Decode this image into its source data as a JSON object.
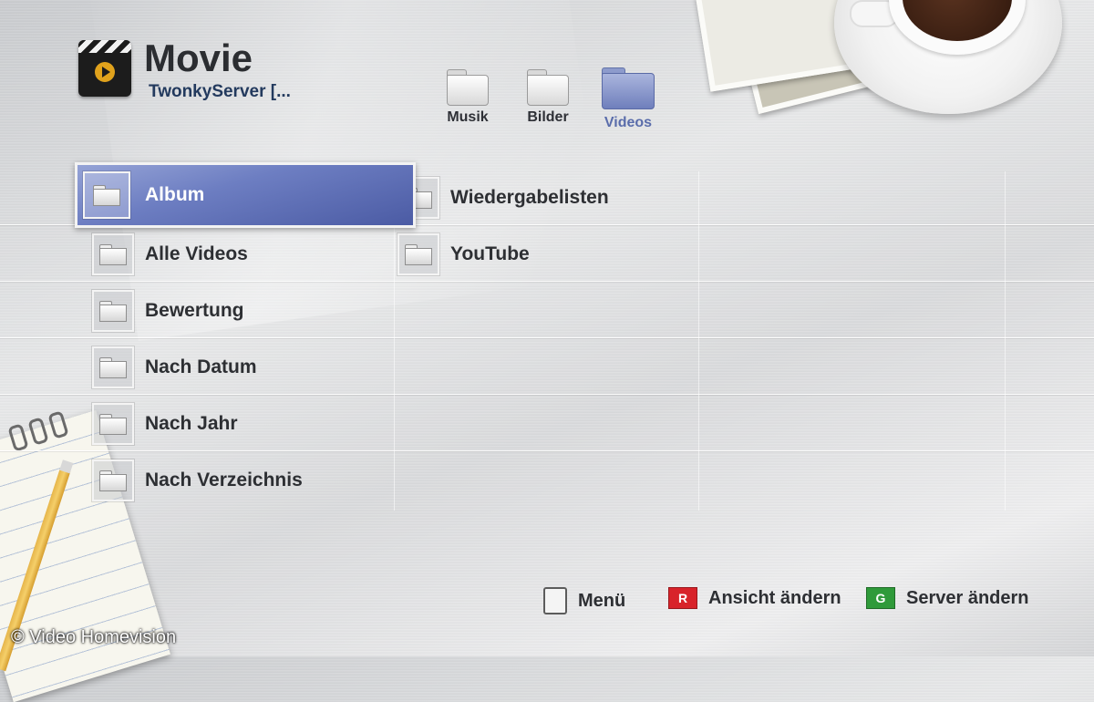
{
  "header": {
    "title": "Movie",
    "server": "TwonkyServer [..."
  },
  "categories": [
    {
      "label": "Musik",
      "icon": "folder-icon"
    },
    {
      "label": "Bilder",
      "icon": "folder-icon"
    },
    {
      "label": "Videos",
      "icon": "folder-icon",
      "active": true
    }
  ],
  "items": [
    {
      "label": "Album",
      "selected": true
    },
    {
      "label": "Wiedergabelisten"
    },
    {
      "label": "Alle Videos"
    },
    {
      "label": "YouTube"
    },
    {
      "label": "Bewertung"
    },
    {
      "label": "Nach Datum"
    },
    {
      "label": "Nach Jahr"
    },
    {
      "label": "Nach Verzeichnis"
    }
  ],
  "footer": {
    "menu_label": "Menü",
    "red_key": "R",
    "red_label": "Ansicht ändern",
    "green_key": "G",
    "green_label": "Server ändern"
  },
  "colors": {
    "accent": "#5a6dab",
    "red_key": "#d8232a",
    "green_key": "#2f9a3a"
  },
  "watermark": "© Video Homevision"
}
